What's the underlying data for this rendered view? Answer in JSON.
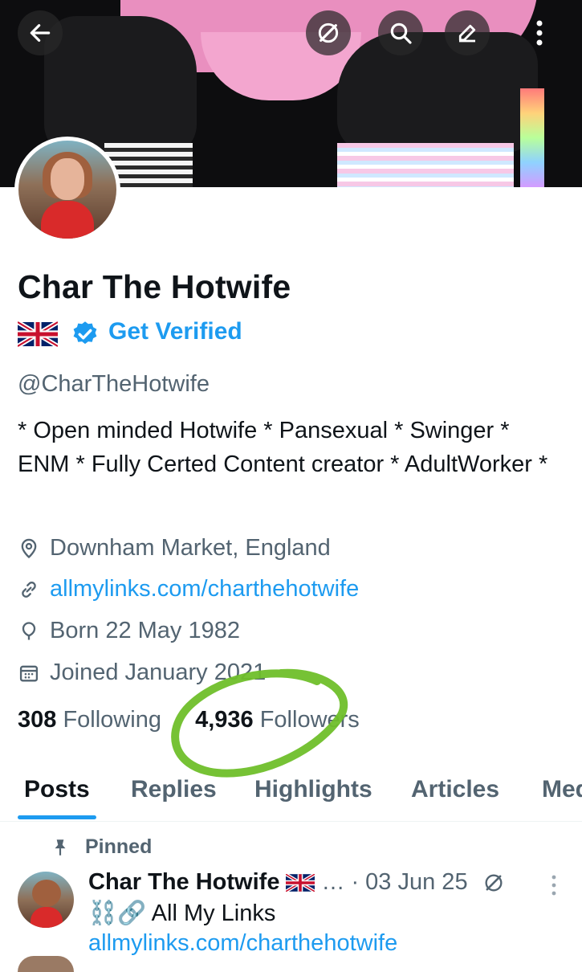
{
  "profile": {
    "display_name": "Char The Hotwife",
    "flag_name": "uk-flag-icon",
    "get_verified": "Get Verified",
    "handle": "@CharTheHotwife",
    "bio": "* Open minded Hotwife * Pansexual * Swinger * ENM * Fully Certed Content creator * AdultWorker *",
    "location": "Downham Market, England",
    "link": "allmylinks.com/charthehotwife",
    "born": "Born 22 May 1982",
    "joined": "Joined January 2021"
  },
  "stats": {
    "following_count": "308",
    "following_label": "Following",
    "followers_count": "4,936",
    "followers_label": "Followers"
  },
  "tabs": [
    "Posts",
    "Replies",
    "Highlights",
    "Articles",
    "Media"
  ],
  "pinned_post": {
    "pinned_label": "Pinned",
    "author": "Char The Hotwife",
    "ellipsis": "…",
    "date": "· 03 Jun 25",
    "text": "⛓️🔗 All My Links",
    "link": "allmylinks.com/charthehotwife"
  },
  "icons": {
    "back": "back-arrow-icon",
    "grok": "grok-icon",
    "search": "search-icon",
    "edit": "edit-icon",
    "more": "more-vertical-icon",
    "location": "location-pin-icon",
    "link": "link-icon",
    "born": "balloon-icon",
    "joined": "calendar-icon",
    "pin": "pin-icon"
  },
  "colors": {
    "accent": "#1d9bf0",
    "secondary_text": "#536471",
    "annotation_circle": "#6fbf2a"
  }
}
